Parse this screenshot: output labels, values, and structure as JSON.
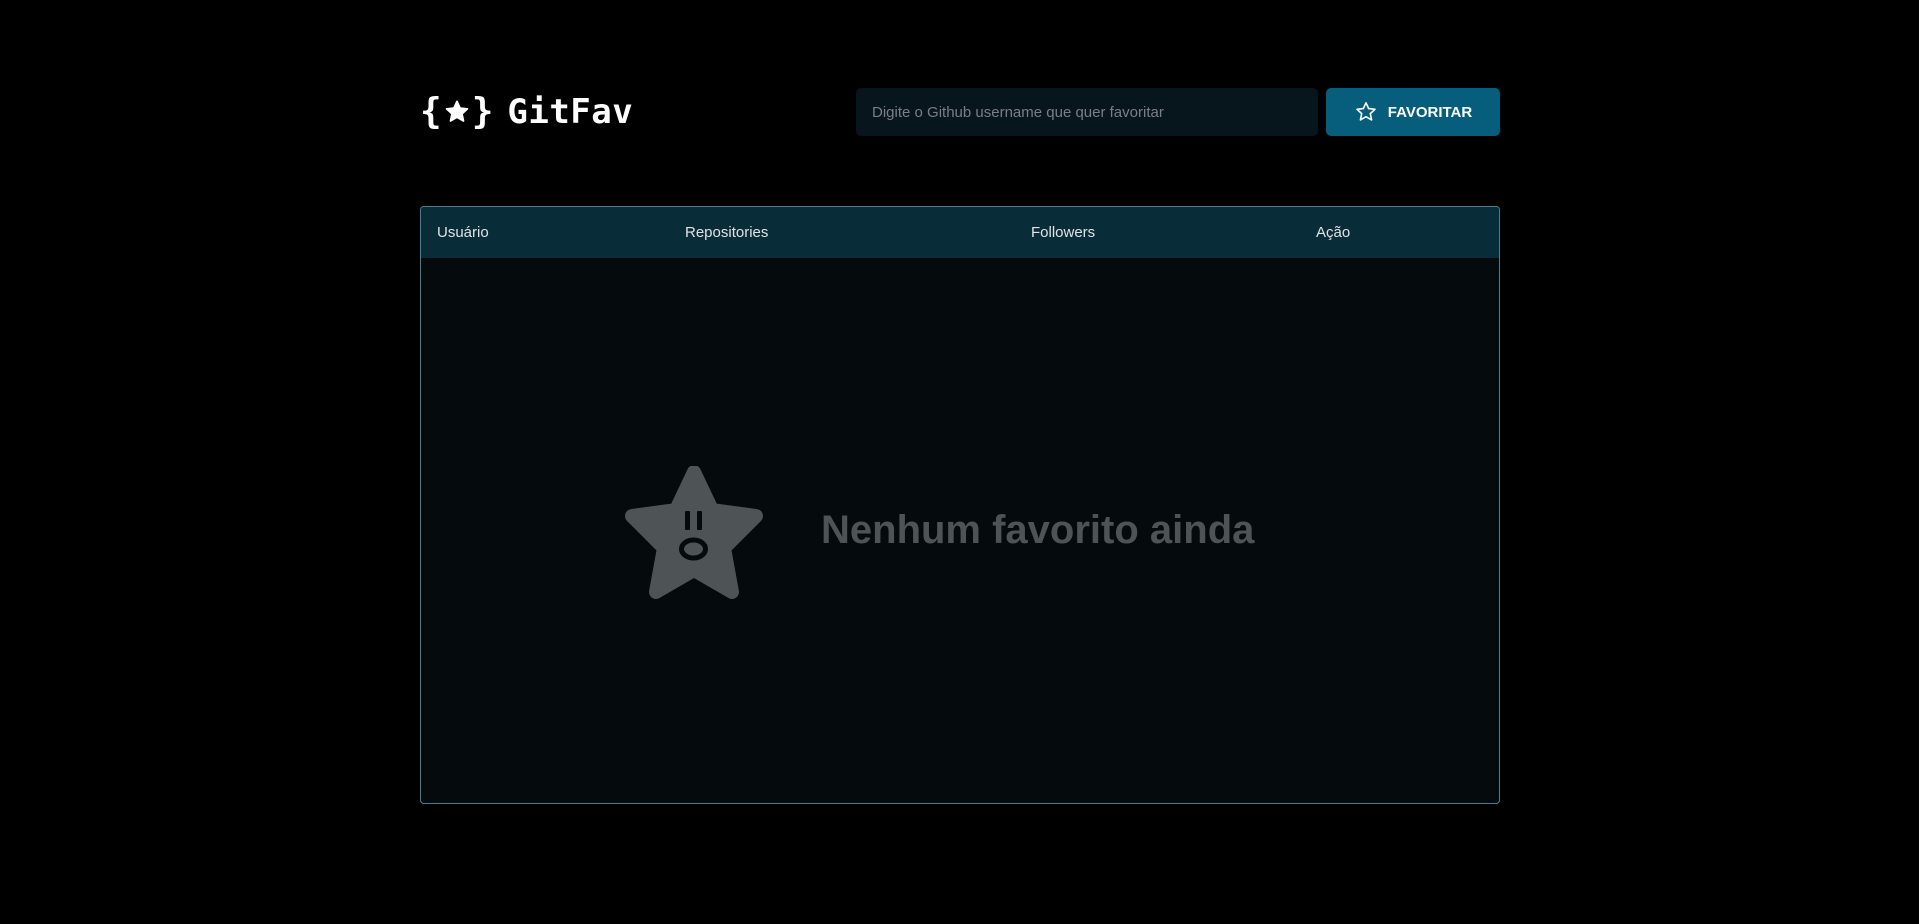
{
  "header": {
    "logo_text": "GitFav",
    "search_placeholder": "Digite o Github username que quer favoritar",
    "favorite_button_label": "FAVORITAR"
  },
  "table": {
    "columns": [
      "Usuário",
      "Repositories",
      "Followers",
      "Ação"
    ],
    "rows": []
  },
  "empty_state": {
    "message": "Nenhum favorito ainda",
    "icon": "surprised-star-icon"
  },
  "colors": {
    "background": "#000000",
    "table_header": "#092d38",
    "table_body": "#050a0d",
    "table_border": "#4a808c",
    "button": "#065e7c",
    "input": "#06161c",
    "empty_text": "#4e5455",
    "empty_icon": "#4e5455"
  },
  "icons": {
    "logo": "braces-star-icon",
    "button": "star-outline-icon"
  }
}
